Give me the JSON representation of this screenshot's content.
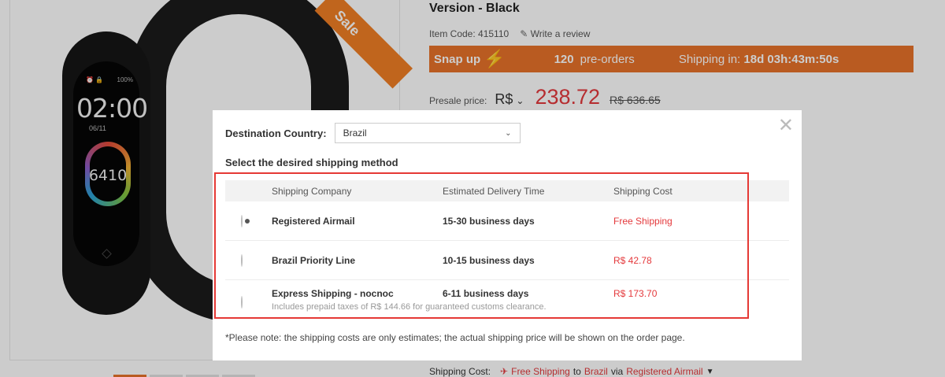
{
  "product": {
    "title": "Version - Black",
    "item_code": "Item Code: 415110",
    "write_review": "Write a review",
    "sale_ribbon": "Sale",
    "snap_up": "Snap up",
    "preorders_count": "120",
    "preorders_label": "pre-orders",
    "shipping_in_label": "Shipping in:",
    "shipping_in_value": "18d 03h:43m:50s",
    "presale_label": "Presale price:",
    "currency": "R$",
    "price": "238.72",
    "old_price": "R$ 636.65",
    "shipping_cost_label": "Shipping Cost:",
    "free_shipping": "Free Shipping",
    "to": "to",
    "to_country": "Brazil",
    "via": "via",
    "via_method": "Registered Airmail"
  },
  "band": {
    "time": "02:00",
    "date": "06/11",
    "steps": "6410",
    "status_left": "⏰ 🔒",
    "status_right": "100%"
  },
  "modal": {
    "destination_label": "Destination Country:",
    "destination_value": "Brazil",
    "select_method_title": "Select the desired shipping method",
    "headers": {
      "company": "Shipping Company",
      "time": "Estimated Delivery Time",
      "cost": "Shipping Cost"
    },
    "rows": [
      {
        "company": "Registered Airmail",
        "time": "15-30 business days",
        "cost": "Free Shipping",
        "sub": "",
        "selected": true
      },
      {
        "company": "Brazil Priority Line",
        "time": "10-15 business days",
        "cost": "R$ 42.78",
        "sub": "",
        "selected": false
      },
      {
        "company": "Express Shipping - nocnoc",
        "time": "6-11 business days",
        "cost": "R$ 173.70",
        "sub": "Includes prepaid taxes of R$ 144.66 for guaranteed customs clearance.",
        "selected": false
      }
    ],
    "note": "*Please note: the shipping costs are only estimates; the actual shipping price will be shown on the order page."
  },
  "colors": {
    "accent_orange": "#e8722a",
    "price_red": "#e4393c",
    "highlight_red": "#e53935"
  }
}
